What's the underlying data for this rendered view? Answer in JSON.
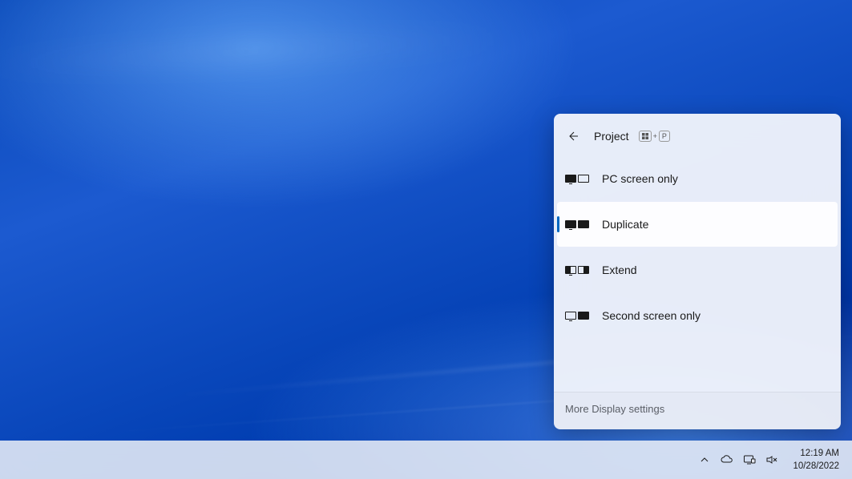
{
  "panel": {
    "title": "Project",
    "shortcut_key2": "P",
    "options": [
      {
        "label": "PC screen only",
        "selected": false,
        "icon": "pc-only"
      },
      {
        "label": "Duplicate",
        "selected": true,
        "icon": "duplicate"
      },
      {
        "label": "Extend",
        "selected": false,
        "icon": "extend"
      },
      {
        "label": "Second screen only",
        "selected": false,
        "icon": "second-only"
      }
    ],
    "footer_link": "More Display settings"
  },
  "taskbar": {
    "time": "12:19 AM",
    "date": "10/28/2022"
  }
}
